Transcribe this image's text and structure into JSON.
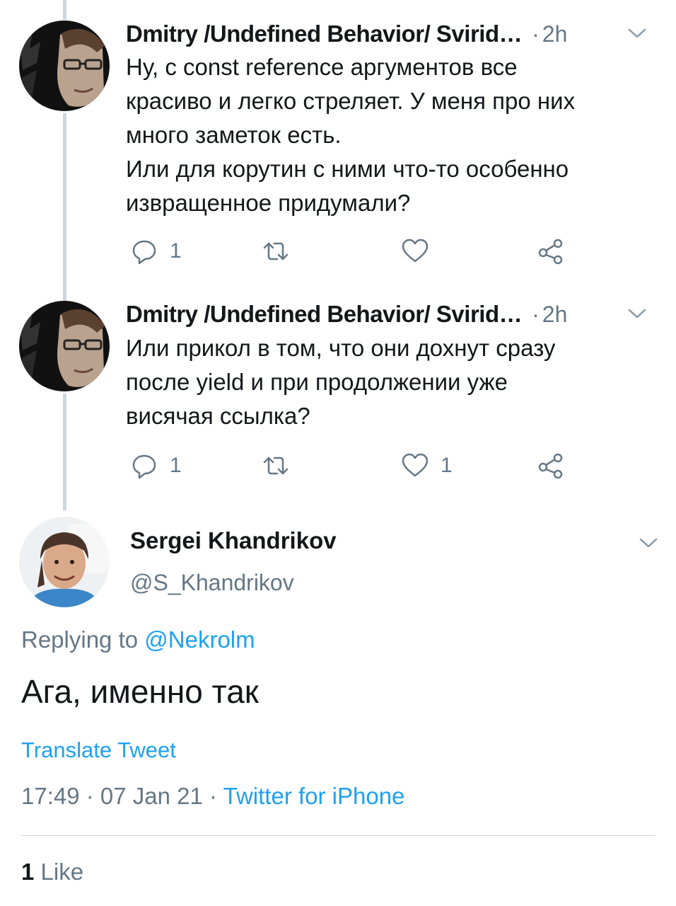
{
  "tweets": [
    {
      "author": "Dmitry /Undefined Behavior/ Svirid…",
      "dot": "·",
      "time": "2h",
      "lines": [
        "Ну, с const reference аргументов все",
        "красиво и легко стреляет. У меня про них",
        "много заметок есть.",
        "Или для корутин с ними что-то особенно",
        "извращенное придумали?"
      ],
      "reply_count": "1",
      "retweet_count": "",
      "like_count": ""
    },
    {
      "author": "Dmitry /Undefined Behavior/ Svirid…",
      "dot": "·",
      "time": "2h",
      "lines": [
        "Или прикол в том, что они дохнут сразу",
        "после yield и при продолжении уже",
        "висячая ссылка?"
      ],
      "reply_count": "1",
      "retweet_count": "",
      "like_count": "1"
    }
  ],
  "main_tweet": {
    "author": "Sergei Khandrikov",
    "handle": "@S_Khandrikov",
    "replying_prefix": "Replying to ",
    "replying_to": "@Nekrolm",
    "text": "Ага, именно так",
    "translate_label": "Translate Tweet",
    "time": "17:49",
    "date": "07 Jan 21",
    "sep": " · ",
    "source": "Twitter for iPhone",
    "likes_count": "1",
    "likes_label": "Like"
  },
  "colors": {
    "accent": "#1da1f2",
    "secondary_text": "#657786",
    "primary_text": "#14171a",
    "thread_line": "#ccd6dd"
  },
  "icons": [
    "reply-icon",
    "retweet-icon",
    "like-icon",
    "share-icon",
    "chevron-down-icon"
  ]
}
